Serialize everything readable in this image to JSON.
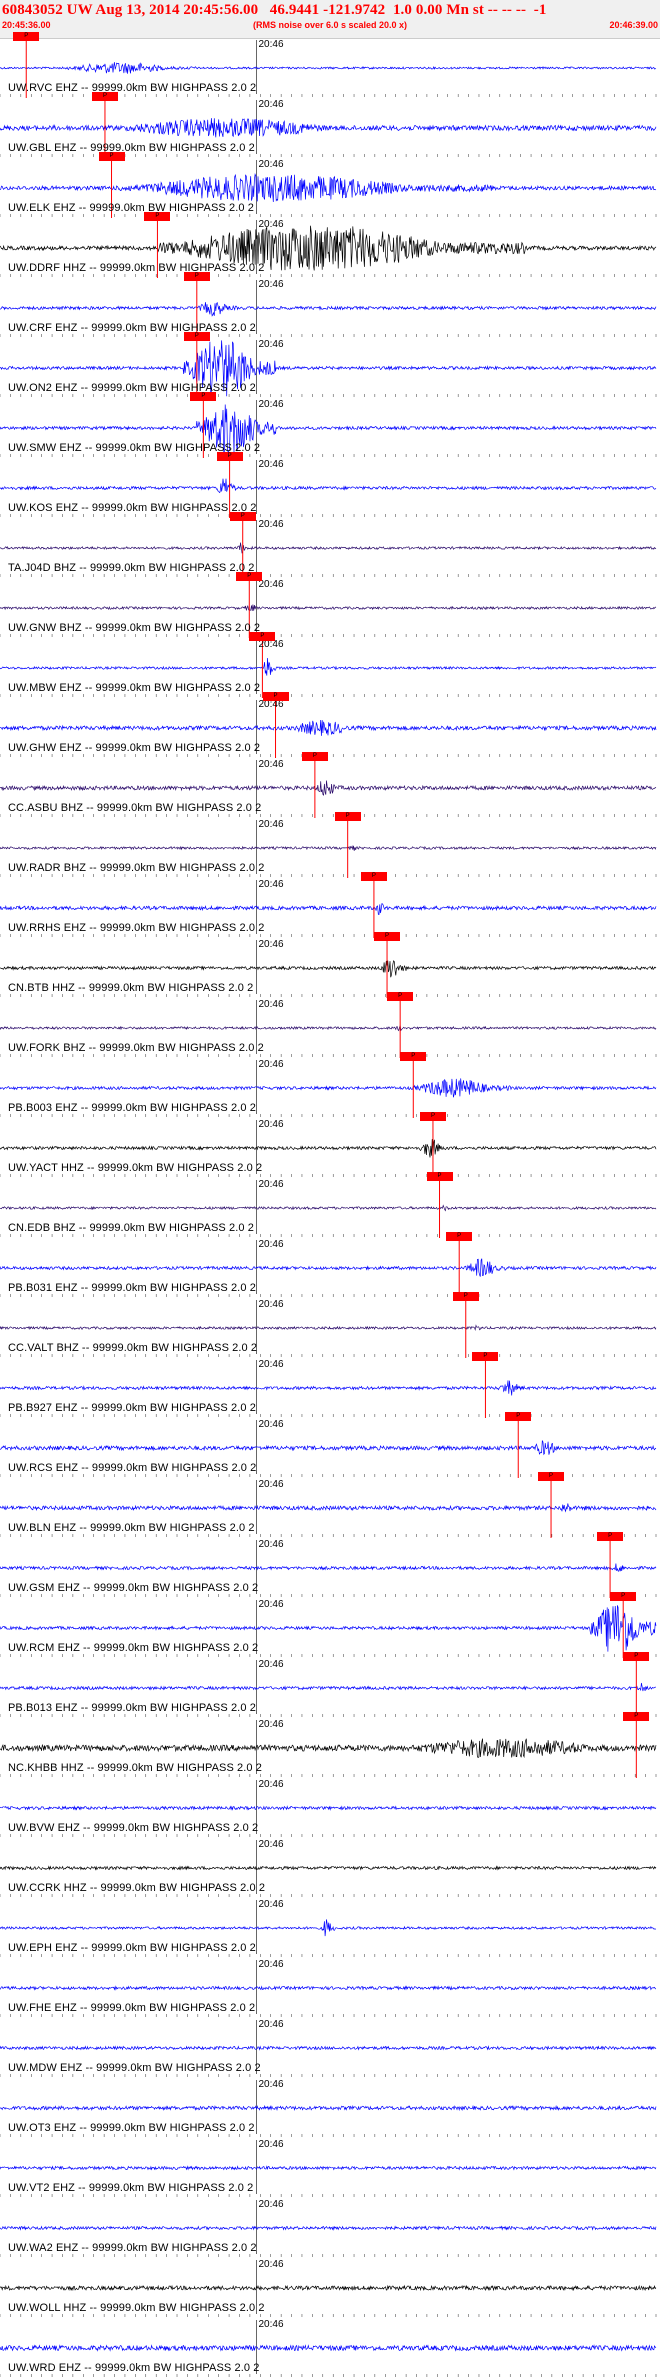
{
  "header": {
    "title": "60843052 UW Aug 13, 2014 20:45:56.00   46.9441 -121.9742  1.0 0.00 Mn st -- -- --  -1",
    "subtitle": "(RMS noise over 6.0 s scaled 20.0 x)",
    "start_time": "20:45:36.00",
    "end_time": "20:46:39.00"
  },
  "tick_label": "20:46",
  "pick_label": "P",
  "colors": {
    "accent": "#ff0000",
    "trace_blue": "#0000ff",
    "trace_black": "#000000",
    "trace_purple": "#2a0a6a",
    "header_bg": "#f0f0f0"
  },
  "stations": [
    {
      "label": "UW.RVC EHZ -- 99999.0km BW  HIGHPASS  2.0  2",
      "color": "#0000ff",
      "pick": 0.04,
      "amp": 1.0,
      "burst": [
        0.1,
        0.3
      ],
      "burst_amp": 6
    },
    {
      "label": "UW.GBL EHZ -- 99999.0km BW  HIGHPASS  2.0  2",
      "color": "#0000ff",
      "pick": 0.16,
      "amp": 2.5,
      "burst": [
        0.16,
        0.6
      ],
      "burst_amp": 10
    },
    {
      "label": "UW.ELK EHZ -- 99999.0km BW  HIGHPASS  2.0  2",
      "color": "#0000ff",
      "pick": 0.17,
      "amp": 2.0,
      "burst": [
        0.18,
        0.75
      ],
      "burst_amp": 14
    },
    {
      "label": "UW.DDRF HHZ -- 99999.0km BW  HIGHPASS  2.0  2",
      "color": "#000000",
      "pick": 0.24,
      "amp": 2.0,
      "burst": [
        0.24,
        0.8
      ],
      "burst_amp": 24
    },
    {
      "label": "UW.CRF EHZ -- 99999.0km BW  HIGHPASS  2.0  2",
      "color": "#0000ff",
      "pick": 0.3,
      "amp": 1.5,
      "burst": [
        0.3,
        0.36
      ],
      "burst_amp": 8
    },
    {
      "label": "UW.ON2 EHZ -- 99999.0km BW  HIGHPASS  2.0  2",
      "color": "#0000ff",
      "pick": 0.3,
      "amp": 1.5,
      "burst": [
        0.28,
        0.42
      ],
      "burst_amp": 30
    },
    {
      "label": "UW.SMW EHZ -- 99999.0km BW  HIGHPASS  2.0  2",
      "color": "#0000ff",
      "pick": 0.31,
      "amp": 1.5,
      "burst": [
        0.3,
        0.42
      ],
      "burst_amp": 28
    },
    {
      "label": "UW.KOS EHZ -- 99999.0km BW  HIGHPASS  2.0  2",
      "color": "#0000ff",
      "pick": 0.35,
      "amp": 1.5,
      "burst": [
        0.33,
        0.36
      ],
      "burst_amp": 12
    },
    {
      "label": "TA.J04D BHZ -- 99999.0km BW  HIGHPASS  2.0  2",
      "color": "#2a0a6a",
      "pick": 0.37,
      "amp": 1.2,
      "burst": [
        0.36,
        0.38
      ],
      "burst_amp": 6
    },
    {
      "label": "UW.GNW BHZ -- 99999.0km BW  HIGHPASS  2.0  2",
      "color": "#2a0a6a",
      "pick": 0.38,
      "amp": 1.2,
      "burst": [
        0.37,
        0.4
      ],
      "burst_amp": 4
    },
    {
      "label": "UW.MBW EHZ -- 99999.0km BW  HIGHPASS  2.0  2",
      "color": "#0000ff",
      "pick": 0.4,
      "amp": 1.2,
      "burst": [
        0.4,
        0.42
      ],
      "burst_amp": 12
    },
    {
      "label": "UW.GHW EHZ -- 99999.0km BW  HIGHPASS  2.0  2",
      "color": "#0000ff",
      "pick": 0.42,
      "amp": 2.0,
      "burst": [
        0.44,
        0.56
      ],
      "burst_amp": 8
    },
    {
      "label": "CC.ASBU BHZ -- 99999.0km BW  HIGHPASS  2.0  2",
      "color": "#2a0a6a",
      "pick": 0.48,
      "amp": 2.0,
      "burst": [
        0.48,
        0.52
      ],
      "burst_amp": 10
    },
    {
      "label": "UW.RADR BHZ -- 99999.0km BW  HIGHPASS  2.0  2",
      "color": "#2a0a6a",
      "pick": 0.53,
      "amp": 1.2,
      "burst": [
        0.53,
        0.55
      ],
      "burst_amp": 3
    },
    {
      "label": "UW.RRHS EHZ -- 99999.0km BW  HIGHPASS  2.0  2",
      "color": "#0000ff",
      "pick": 0.57,
      "amp": 1.8,
      "burst": [
        0.57,
        0.59
      ],
      "burst_amp": 8
    },
    {
      "label": "CN.BTB HHZ -- 99999.0km BW  HIGHPASS  2.0  2",
      "color": "#000000",
      "pick": 0.59,
      "amp": 1.5,
      "burst": [
        0.58,
        0.62
      ],
      "burst_amp": 12
    },
    {
      "label": "UW.FORK BHZ -- 99999.0km BW  HIGHPASS  2.0  2",
      "color": "#2a0a6a",
      "pick": 0.61,
      "amp": 1.2,
      "burst": [
        0.6,
        0.62
      ],
      "burst_amp": 3
    },
    {
      "label": "PB.B003 EHZ -- 99999.0km BW  HIGHPASS  2.0  2",
      "color": "#0000ff",
      "pick": 0.63,
      "amp": 1.5,
      "burst": [
        0.63,
        0.78
      ],
      "burst_amp": 10
    },
    {
      "label": "UW.YACT HHZ -- 99999.0km BW  HIGHPASS  2.0  2",
      "color": "#000000",
      "pick": 0.66,
      "amp": 1.5,
      "burst": [
        0.64,
        0.68
      ],
      "burst_amp": 10
    },
    {
      "label": "CN.EDB BHZ -- 99999.0km BW  HIGHPASS  2.0  2",
      "color": "#2a0a6a",
      "pick": 0.67,
      "amp": 1.2,
      "burst": [
        0.67,
        0.69
      ],
      "burst_amp": 3
    },
    {
      "label": "PB.B031 EHZ -- 99999.0km BW  HIGHPASS  2.0  2",
      "color": "#0000ff",
      "pick": 0.7,
      "amp": 1.5,
      "burst": [
        0.71,
        0.77
      ],
      "burst_amp": 10
    },
    {
      "label": "CC.VALT BHZ -- 99999.0km BW  HIGHPASS  2.0  2",
      "color": "#2a0a6a",
      "pick": 0.71,
      "amp": 1.2,
      "burst": [
        0.72,
        0.74
      ],
      "burst_amp": 3
    },
    {
      "label": "PB.B927 EHZ -- 99999.0km BW  HIGHPASS  2.0  2",
      "color": "#0000ff",
      "pick": 0.74,
      "amp": 1.5,
      "burst": [
        0.76,
        0.8
      ],
      "burst_amp": 8
    },
    {
      "label": "UW.RCS EHZ -- 99999.0km BW  HIGHPASS  2.0  2",
      "color": "#0000ff",
      "pick": 0.79,
      "amp": 2.0,
      "burst": [
        0.81,
        0.86
      ],
      "burst_amp": 8
    },
    {
      "label": "UW.BLN EHZ -- 99999.0km BW  HIGHPASS  2.0  2",
      "color": "#0000ff",
      "pick": 0.84,
      "amp": 2.0,
      "burst": [
        0.85,
        0.88
      ],
      "burst_amp": 6
    },
    {
      "label": "UW.GSM EHZ -- 99999.0km BW  HIGHPASS  2.0  2",
      "color": "#0000ff",
      "pick": 0.93,
      "amp": 1.5,
      "burst": [
        0.93,
        0.96
      ],
      "burst_amp": 5
    },
    {
      "label": "UW.RCM EHZ -- 99999.0km BW  HIGHPASS  2.0  2",
      "color": "#0000ff",
      "pick": 0.95,
      "amp": 1.5,
      "burst": [
        0.9,
        1.0
      ],
      "burst_amp": 28
    },
    {
      "label": "PB.B013 EHZ -- 99999.0km BW  HIGHPASS  2.0  2",
      "color": "#0000ff",
      "pick": 0.97,
      "amp": 1.5,
      "burst": [
        0.97,
        0.99
      ],
      "burst_amp": 6
    },
    {
      "label": "NC.KHBB HHZ -- 99999.0km BW  HIGHPASS  2.0  2",
      "color": "#000000",
      "pick": 0.97,
      "amp": 3.0,
      "burst": [
        0.6,
        1.0
      ],
      "burst_amp": 10
    },
    {
      "label": "UW.BVW EHZ -- 99999.0km BW  HIGHPASS  2.0  2",
      "color": "#0000ff",
      "pick": null,
      "amp": 1.5,
      "burst": null,
      "burst_amp": 0
    },
    {
      "label": "UW.CCRK HHZ -- 99999.0km BW  HIGHPASS  2.0  2",
      "color": "#000000",
      "pick": null,
      "amp": 1.5,
      "burst": null,
      "burst_amp": 0
    },
    {
      "label": "UW.EPH EHZ -- 99999.0km BW  HIGHPASS  2.0  2",
      "color": "#0000ff",
      "pick": null,
      "amp": 1.2,
      "burst": [
        0.49,
        0.51
      ],
      "burst_amp": 10
    },
    {
      "label": "UW.FHE EHZ -- 99999.0km BW  HIGHPASS  2.0  2",
      "color": "#0000ff",
      "pick": null,
      "amp": 1.5,
      "burst": null,
      "burst_amp": 0
    },
    {
      "label": "UW.MDW EHZ -- 99999.0km BW  HIGHPASS  2.0  2",
      "color": "#0000ff",
      "pick": null,
      "amp": 1.5,
      "burst": null,
      "burst_amp": 0
    },
    {
      "label": "UW.OT3 EHZ -- 99999.0km BW  HIGHPASS  2.0  2",
      "color": "#0000ff",
      "pick": null,
      "amp": 1.8,
      "burst": null,
      "burst_amp": 0
    },
    {
      "label": "UW.VT2 EHZ -- 99999.0km BW  HIGHPASS  2.0  2",
      "color": "#0000ff",
      "pick": null,
      "amp": 1.5,
      "burst": null,
      "burst_amp": 0
    },
    {
      "label": "UW.WA2 EHZ -- 99999.0km BW  HIGHPASS  2.0  2",
      "color": "#0000ff",
      "pick": null,
      "amp": 1.5,
      "burst": null,
      "burst_amp": 0
    },
    {
      "label": "UW.WOLL HHZ -- 99999.0km BW  HIGHPASS  2.0  2",
      "color": "#000000",
      "pick": null,
      "amp": 2.0,
      "burst": null,
      "burst_amp": 0
    },
    {
      "label": "UW.WRD EHZ -- 99999.0km BW  HIGHPASS  2.0  2",
      "color": "#0000ff",
      "pick": null,
      "amp": 2.5,
      "burst": null,
      "burst_amp": 0
    }
  ]
}
